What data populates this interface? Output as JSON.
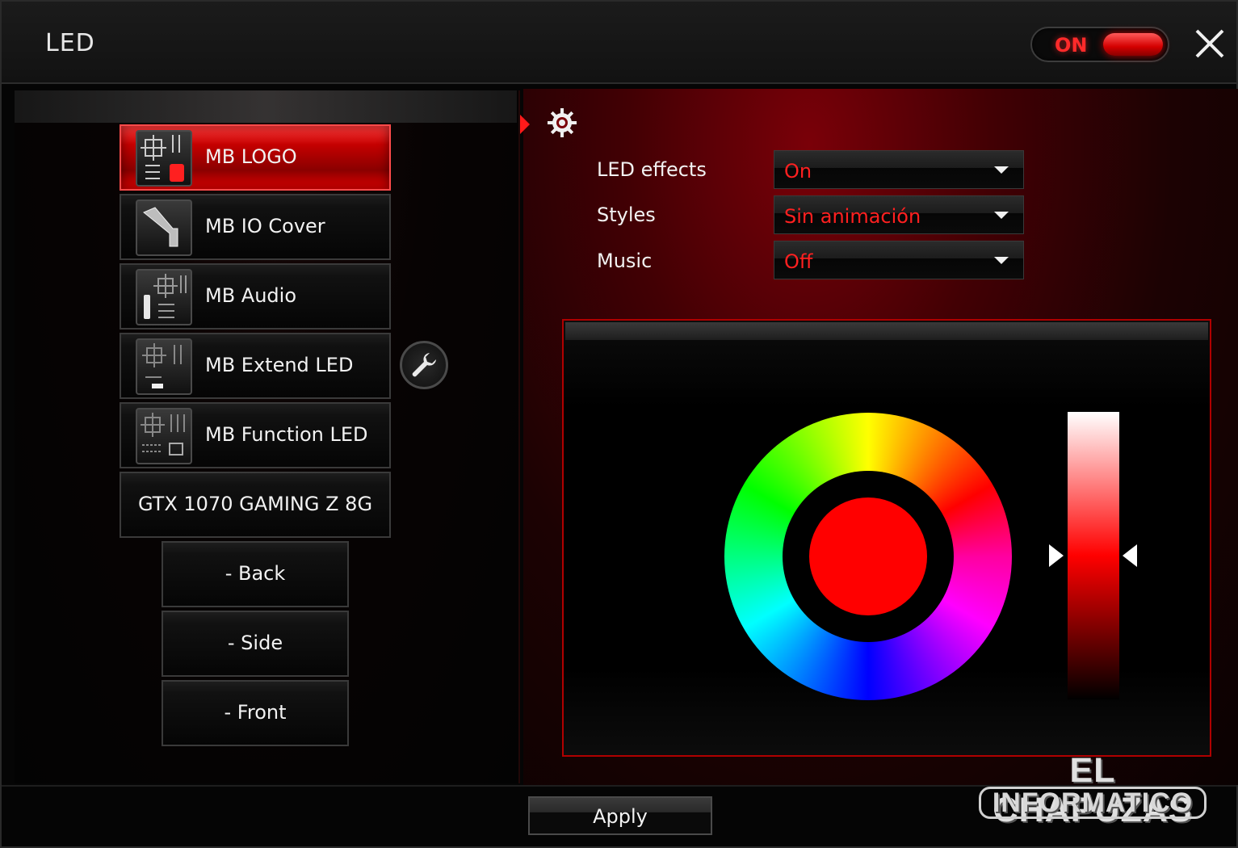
{
  "window": {
    "title": "LED"
  },
  "power": {
    "label": "ON",
    "state": "on"
  },
  "devices": [
    {
      "label": "MB LOGO",
      "icon": "mb-logo-icon",
      "active": true
    },
    {
      "label": "MB IO Cover",
      "icon": "io-cover-icon",
      "active": false
    },
    {
      "label": "MB Audio",
      "icon": "audio-icon",
      "active": false
    },
    {
      "label": "MB Extend LED",
      "icon": "extend-led-icon",
      "active": false
    },
    {
      "label": "MB Function LED",
      "icon": "function-led-icon",
      "active": false
    },
    {
      "label": "GTX 1070 GAMING Z 8G",
      "icon": null,
      "active": false
    }
  ],
  "gpu_zones": [
    {
      "label": "- Back"
    },
    {
      "label": "- Side"
    },
    {
      "label": "- Front"
    }
  ],
  "settings": {
    "led_effects": {
      "label": "LED effects",
      "value": "On"
    },
    "styles": {
      "label": "Styles",
      "value": "Sin animación"
    },
    "music": {
      "label": "Music",
      "value": "Off"
    }
  },
  "color": {
    "selected": "#ff0000",
    "brightness_level": 0.5
  },
  "footer": {
    "apply_label": "Apply"
  },
  "watermark": {
    "line1": "EL CHAPUZAS",
    "line2": "INFORMATICO"
  },
  "colors": {
    "accent": "#ff0000",
    "value_text": "#ff2020"
  }
}
